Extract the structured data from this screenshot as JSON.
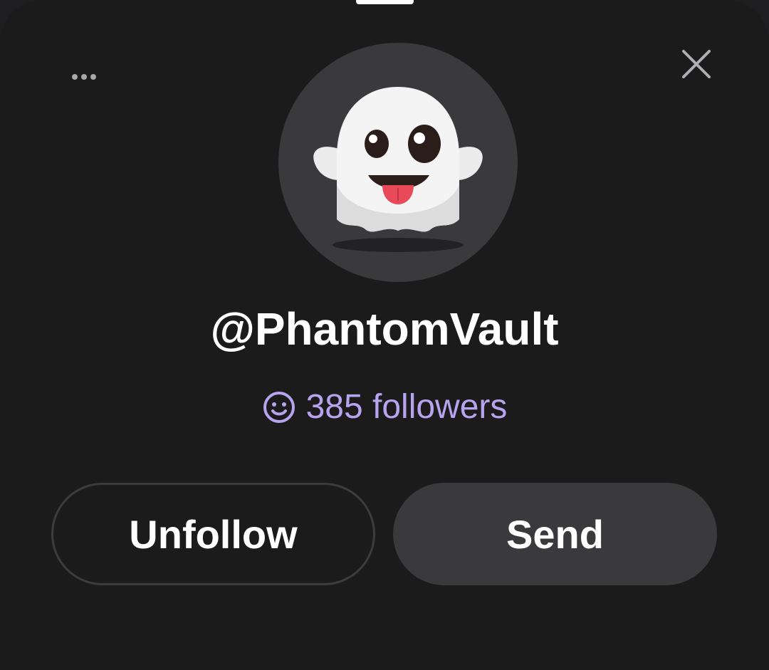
{
  "profile": {
    "username": "@PhantomVault",
    "followers_text": "385 followers",
    "avatar_icon": "ghost-emoji"
  },
  "actions": {
    "unfollow_label": "Unfollow",
    "send_label": "Send"
  },
  "header": {
    "more_icon": "more-horizontal-icon",
    "close_icon": "close-icon"
  },
  "colors": {
    "background": "#1b1b1c",
    "avatar_bg": "#3a3a3c",
    "followers_accent": "#b6a4ef",
    "send_button_bg": "#3a3a3c",
    "unfollow_border": "#3c3c3e"
  }
}
